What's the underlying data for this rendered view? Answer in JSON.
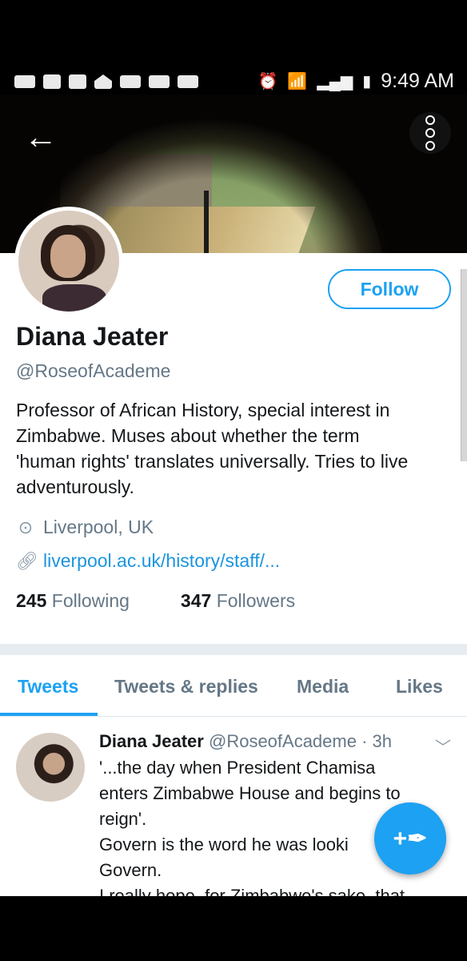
{
  "status_bar": {
    "time": "9:49 AM",
    "left_icons": [
      "message-icon",
      "gallery-icon",
      "flipboard-icon",
      "home-icon",
      "card-icon",
      "card-icon",
      "card-icon"
    ],
    "right_icons": [
      "alarm-icon",
      "wifi-icon",
      "signal-icon",
      "battery-icon"
    ]
  },
  "profile": {
    "name": "Diana Jeater",
    "handle": "@RoseofAcademe",
    "follow_label": "Follow",
    "bio_lines": [
      "Professor of African History, special interest in",
      "Zimbabwe.  Muses about whether the term",
      "'human rights' translates universally. Tries to live",
      "adventurously."
    ],
    "location": "Liverpool, UK",
    "website": "liverpool.ac.uk/history/staff/...",
    "following_count": "245",
    "following_label": "Following",
    "followers_count": "347",
    "followers_label": "Followers"
  },
  "tabs": [
    "Tweets",
    "Tweets & replies",
    "Media",
    "Likes"
  ],
  "active_tab": "Tweets",
  "tweet": {
    "author": "Diana Jeater",
    "handle": "@RoseofAcademe",
    "separator": "·",
    "time": "3h",
    "lines": [
      "'...the day when President Chamisa",
      "enters Zimbabwe House and begins to",
      "reign'.",
      "Govern is the word he was looki",
      "Govern.",
      "I really hope, for Zimbabwe's sake, that"
    ]
  },
  "colors": {
    "accent": "#1da1f2",
    "link": "#1b95e0",
    "secondary_text": "#657786",
    "separator": "#e6ecf0"
  }
}
